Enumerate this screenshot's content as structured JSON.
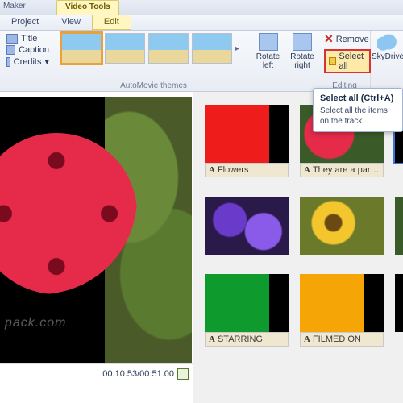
{
  "title_bar": {
    "app": "Maker",
    "tools_tab": "Video Tools"
  },
  "menu": {
    "project": "Project",
    "view": "View",
    "edit": "Edit"
  },
  "ribbon": {
    "title_check": "Title",
    "caption_check": "Caption",
    "credits_check": "Credits",
    "automovie_group": "AutoMovie themes",
    "rotate_left": "Rotate\nleft",
    "rotate_right": "Rotate\nright",
    "remove": "Remove",
    "select_all": "Select all",
    "skydrive": "SkyDrive",
    "editing_group": "Editing"
  },
  "tooltip": {
    "title": "Select all (Ctrl+A)",
    "body": "Select all the items on the track."
  },
  "preview": {
    "watermark": "pack.com",
    "time": "00:10.53/00:51.00"
  },
  "clips": [
    {
      "color": "red",
      "caption": "Flowers"
    },
    {
      "color": "flowerthumb",
      "caption": "They are a part of..."
    },
    {
      "color": "purple",
      "caption": ""
    },
    {
      "color": "sunflower",
      "caption": ""
    },
    {
      "color": "green",
      "caption": "STARRING"
    },
    {
      "color": "orange",
      "caption": "FILMED ON"
    }
  ]
}
